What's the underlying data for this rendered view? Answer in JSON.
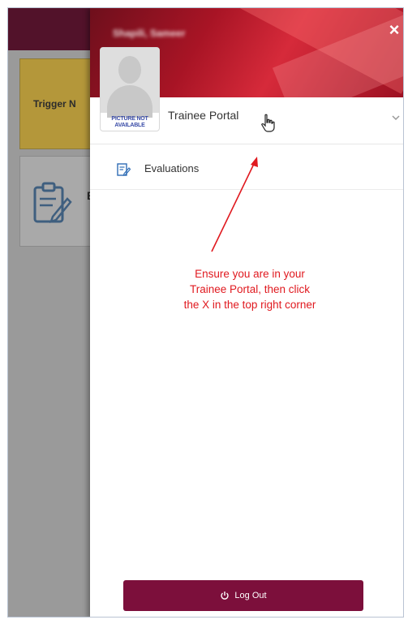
{
  "app": {
    "background_tiles": {
      "trigger_label": "Trigger N",
      "evaluations_initial": "E"
    }
  },
  "drawer": {
    "user_name": "Shapili, Sameer",
    "avatar_caption": "PICTURE NOT AVAILABLE",
    "portal_label": "Trainee Portal",
    "menu": [
      {
        "label": "Evaluations",
        "icon": "evaluation-form-icon"
      }
    ],
    "logout_label": "Log Out",
    "close_symbol": "×"
  },
  "annotation": {
    "lines": [
      "Ensure you are in your",
      "Trainee Portal, then click",
      "the X in the top right corner"
    ],
    "color": "#e0191f"
  },
  "colors": {
    "header_red": "#a81425",
    "logout_maroon": "#7c0f3b",
    "topbar": "#52122a",
    "tile_gold": "#b4973a",
    "overlay_gray": "#9a9a9a"
  }
}
